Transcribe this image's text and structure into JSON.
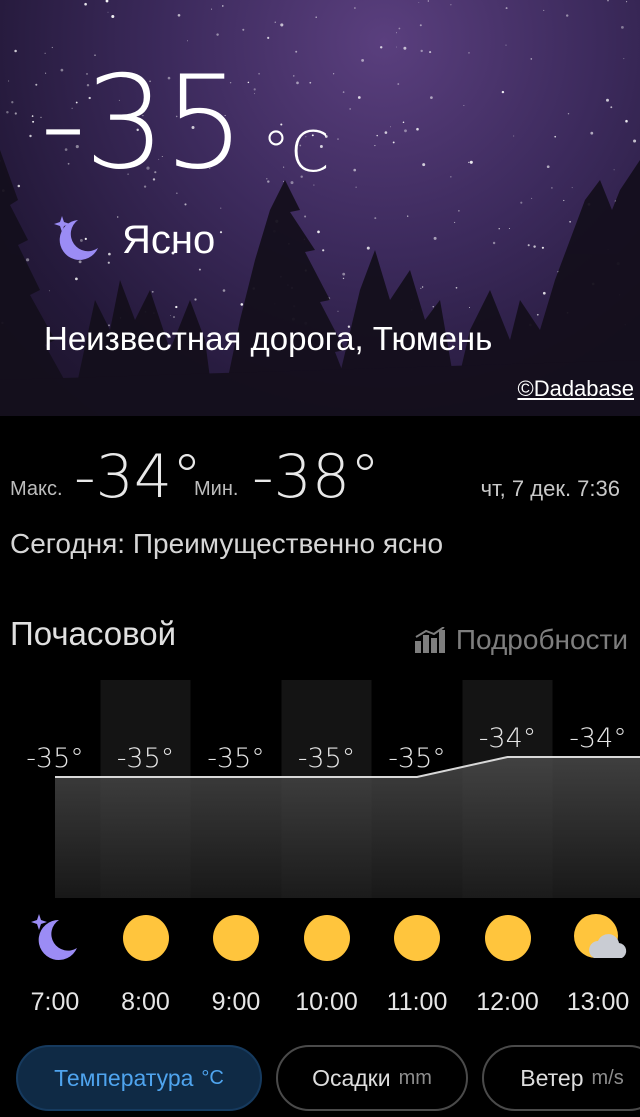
{
  "current": {
    "temperature": "-35",
    "unit": "°C",
    "condition": "Ясно",
    "condition_icon": "moon-stars-icon",
    "location": "Неизвестная дорога, Тюмень",
    "photo_credit": "©Dadabase"
  },
  "summary": {
    "max_label": "Макс.",
    "max_value": "-34°",
    "min_label": "Мин.",
    "min_value": "-38°",
    "datetime": "чт, 7 дек. 7:36",
    "today_text": "Сегодня: Преимущественно ясно"
  },
  "hourly": {
    "title": "Почасовой",
    "details_label": "Подробности",
    "details_icon": "bar-chart-icon",
    "items": [
      {
        "time": "7:00",
        "temp": "-35°",
        "icon": "moon-icon"
      },
      {
        "time": "8:00",
        "temp": "-35°",
        "icon": "sun-icon"
      },
      {
        "time": "9:00",
        "temp": "-35°",
        "icon": "sun-icon"
      },
      {
        "time": "10:00",
        "temp": "-35°",
        "icon": "sun-icon"
      },
      {
        "time": "11:00",
        "temp": "-35°",
        "icon": "sun-icon"
      },
      {
        "time": "12:00",
        "temp": "-34°",
        "icon": "sun-icon"
      },
      {
        "time": "13:00",
        "temp": "-34°",
        "icon": "partly-cloudy-icon"
      }
    ]
  },
  "chart_data": {
    "type": "area",
    "categories": [
      "7:00",
      "8:00",
      "9:00",
      "10:00",
      "11:00",
      "12:00",
      "13:00"
    ],
    "values": [
      -35,
      -35,
      -35,
      -35,
      -35,
      -34,
      -34
    ],
    "ylim": [
      -35,
      -34
    ]
  },
  "tabs": [
    {
      "label": "Температура",
      "unit": "°C",
      "active": true
    },
    {
      "label": "Осадки",
      "unit": "mm",
      "active": false
    },
    {
      "label": "Ветер",
      "unit": "m/s",
      "active": false
    }
  ],
  "colors": {
    "accent": "#4fa4ee",
    "moon": "#9b8cf5",
    "sun": "#ffc53d"
  }
}
